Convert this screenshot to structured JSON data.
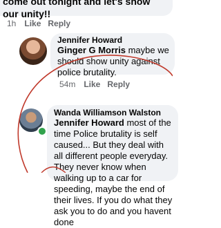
{
  "top_comment": {
    "text": "come out tonight and let's show our unity!!",
    "time": "1h",
    "like": "Like",
    "reply": "Reply"
  },
  "comment_jennifer": {
    "author": "Jennifer Howard",
    "mention": "Ginger G Morris",
    "text": " maybe we should show unity against police brutality.",
    "time": "54m",
    "like": "Like",
    "reply": "Reply"
  },
  "comment_wanda": {
    "author": "Wanda Williamson Walston",
    "mention": "Jennifer Howard",
    "text": " most of the time Police brutality is self caused... But they deal with all different people everyday. They never know when walking up to a car for speeding, maybe the end of their lives. If you do what they ask you to do and you havent done"
  },
  "colors": {
    "bubble": "#f0f2f5",
    "meta": "#65676b",
    "annotation": "#c0392b",
    "online": "#31a24c"
  }
}
